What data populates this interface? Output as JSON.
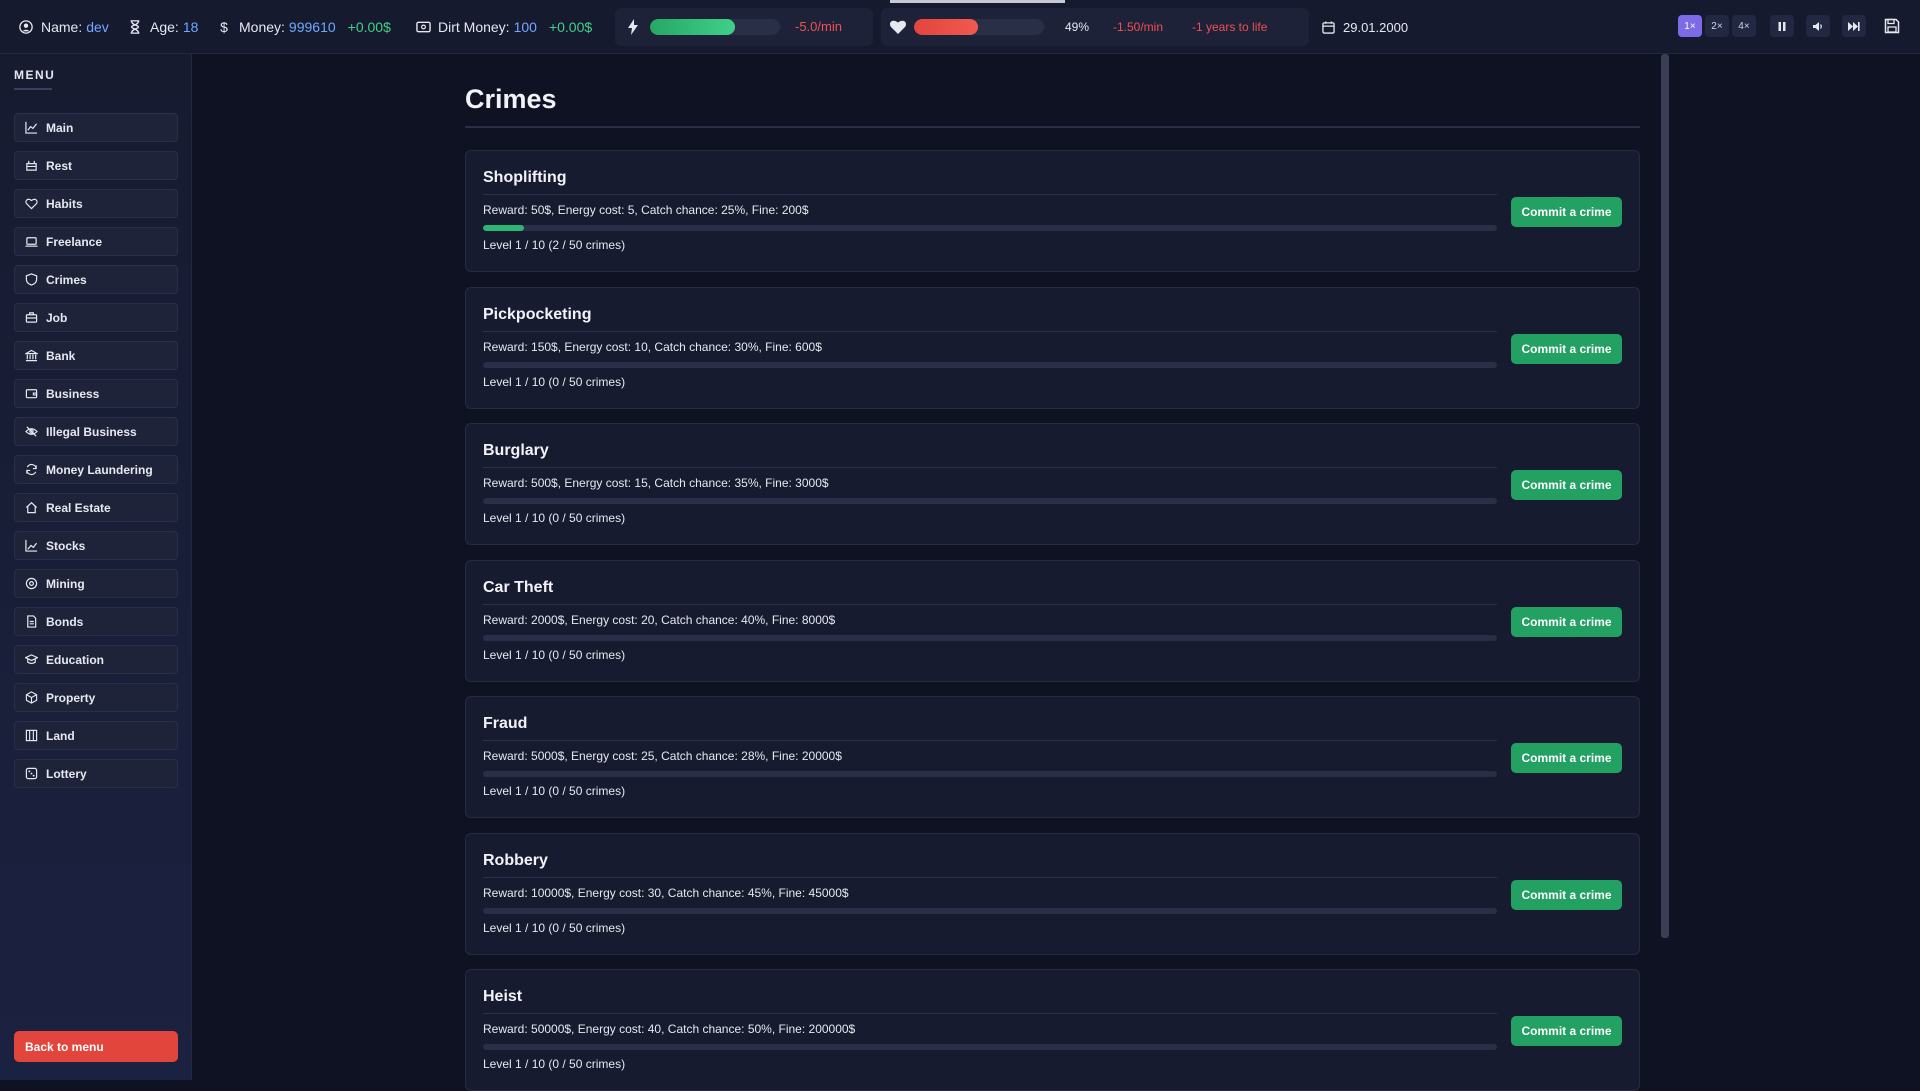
{
  "topbar": {
    "name_label": "Name:",
    "name_value": "dev",
    "age_label": "Age:",
    "age_value": "18",
    "money_label": "Money:",
    "money_value": "999610",
    "money_delta": "+0.00$",
    "dirt_label": "Dirt Money:",
    "dirt_value": "100",
    "dirt_delta": "+0.00$",
    "energy_fill": 0.65,
    "energy_rate": "-5.0/min",
    "health_fill": 0.49,
    "health_percent": "49%",
    "health_rate": "-1.50/min",
    "health_life": "-1 years to life",
    "date": "29.01.2000",
    "speeds": [
      "1×",
      "2×",
      "4×"
    ],
    "colors": {
      "energy": "#2bb673",
      "health": "#e2453c",
      "accent": "#7c6ae6"
    }
  },
  "sidebar": {
    "title": "MENU",
    "items": [
      {
        "label": "Main",
        "icon": "chart-line-icon"
      },
      {
        "label": "Rest",
        "icon": "bed-icon"
      },
      {
        "label": "Habits",
        "icon": "heart-icon"
      },
      {
        "label": "Freelance",
        "icon": "laptop-icon"
      },
      {
        "label": "Crimes",
        "icon": "shield-icon"
      },
      {
        "label": "Job",
        "icon": "briefcase-icon"
      },
      {
        "label": "Bank",
        "icon": "bank-icon"
      },
      {
        "label": "Business",
        "icon": "wallet-icon"
      },
      {
        "label": "Illegal Business",
        "icon": "eye-off-icon"
      },
      {
        "label": "Money Laundering",
        "icon": "refresh-icon"
      },
      {
        "label": "Real Estate",
        "icon": "home-icon"
      },
      {
        "label": "Stocks",
        "icon": "trend-icon"
      },
      {
        "label": "Mining",
        "icon": "gear-icon"
      },
      {
        "label": "Bonds",
        "icon": "document-icon"
      },
      {
        "label": "Education",
        "icon": "graduation-cap-icon"
      },
      {
        "label": "Property",
        "icon": "box-icon"
      },
      {
        "label": "Land",
        "icon": "map-icon"
      },
      {
        "label": "Lottery",
        "icon": "dice-icon"
      }
    ],
    "back_label": "Back to menu"
  },
  "main": {
    "title": "Crimes",
    "commit_label": "Commit a crime",
    "crimes": [
      {
        "name": "Shoplifting",
        "info": "Reward: 50$, Energy cost: 5, Catch chance: 25%, Fine: 200$",
        "progress": 0.04,
        "level": "Level 1 / 10 (2 / 50 crimes)"
      },
      {
        "name": "Pickpocketing",
        "info": "Reward: 150$, Energy cost: 10, Catch chance: 30%, Fine: 600$",
        "progress": 0,
        "level": "Level 1 / 10 (0 / 50 crimes)"
      },
      {
        "name": "Burglary",
        "info": "Reward: 500$, Energy cost: 15, Catch chance: 35%, Fine: 3000$",
        "progress": 0,
        "level": "Level 1 / 10 (0 / 50 crimes)"
      },
      {
        "name": "Car Theft",
        "info": "Reward: 2000$, Energy cost: 20, Catch chance: 40%, Fine: 8000$",
        "progress": 0,
        "level": "Level 1 / 10 (0 / 50 crimes)"
      },
      {
        "name": "Fraud",
        "info": "Reward: 5000$, Energy cost: 25, Catch chance: 28%, Fine: 20000$",
        "progress": 0,
        "level": "Level 1 / 10 (0 / 50 crimes)"
      },
      {
        "name": "Robbery",
        "info": "Reward: 10000$, Energy cost: 30, Catch chance: 45%, Fine: 45000$",
        "progress": 0,
        "level": "Level 1 / 10 (0 / 50 crimes)"
      },
      {
        "name": "Heist",
        "info": "Reward: 50000$, Energy cost: 40, Catch chance: 50%, Fine: 200000$",
        "progress": 0,
        "level": "Level 1 / 10 (0 / 50 crimes)"
      }
    ]
  }
}
